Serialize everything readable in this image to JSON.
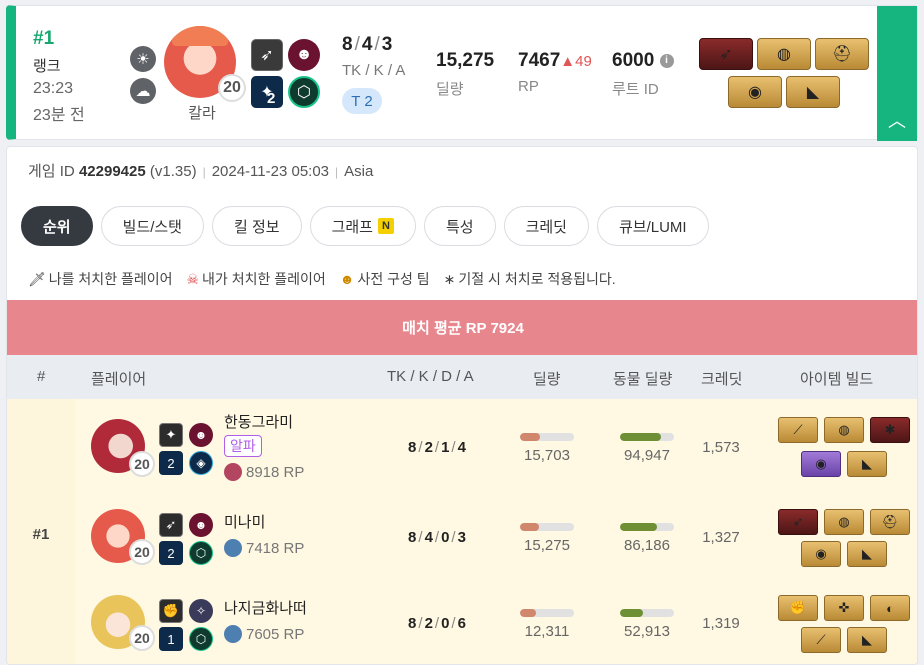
{
  "summary": {
    "rank_num": "#1",
    "rank_label": "랭크",
    "duration": "23:23",
    "ago": "23분 전",
    "character_name": "칼라",
    "level": "20",
    "trait_count": "2",
    "kda": {
      "tk": "8",
      "k": "4",
      "a": "3",
      "sep": "/"
    },
    "kda_label": "TK / K / A",
    "tier_badge": "T 2",
    "damage": "15,275",
    "damage_label": "딜량",
    "rp": "7467",
    "rp_delta": "▲49",
    "rp_label": "RP",
    "route_id": "6000",
    "route_info_icon": "i",
    "route_label": "루트 ID",
    "expand_icon": "︿"
  },
  "detail": {
    "game_id_label": "게임 ID",
    "game_id": "42299425",
    "version": "(v1.35)",
    "datetime": "2024-11-23 05:03",
    "region": "Asia",
    "meta_sep": "|",
    "tabs": [
      {
        "label": "순위",
        "active": true
      },
      {
        "label": "빌드/스탯",
        "active": false
      },
      {
        "label": "킬 정보",
        "active": false
      },
      {
        "label": "그래프",
        "active": false,
        "new": "N"
      },
      {
        "label": "특성",
        "active": false
      },
      {
        "label": "크레딧",
        "active": false
      },
      {
        "label": "큐브/LUMI",
        "active": false
      }
    ],
    "legend": [
      {
        "icon": "🗡",
        "text": "나를 처치한 플레이어"
      },
      {
        "icon": "☠",
        "text": "내가 처치한 플레이어"
      },
      {
        "icon": "☻",
        "text": "사전 구성 팀"
      },
      {
        "icon": "∗",
        "text": "기절 시 처치로 적용됩니다."
      }
    ],
    "avg_rp": "매치 평균 RP 7924",
    "headers": {
      "rank": "#",
      "player": "플레이어",
      "kda": "TK / K / D / A",
      "damage": "딜량",
      "animal_damage": "동물 딜량",
      "credit": "크레딧",
      "items": "아이템 빌드"
    },
    "team_rank": "#1",
    "players": [
      {
        "name": "한동그라미",
        "badge": "알파",
        "rp": "8918 RP",
        "level": "20",
        "trait": "2",
        "tk": "8",
        "k": "2",
        "d": "1",
        "a": "4",
        "damage": "15,703",
        "damage_ratio": 0.37,
        "animal_damage": "94,947",
        "animal_ratio": 0.76,
        "credit": "1,573"
      },
      {
        "name": "미나미",
        "badge": "",
        "rp": "7418 RP",
        "level": "20",
        "trait": "2",
        "tk": "8",
        "k": "4",
        "d": "0",
        "a": "3",
        "damage": "15,275",
        "damage_ratio": 0.36,
        "animal_damage": "86,186",
        "animal_ratio": 0.69,
        "credit": "1,327"
      },
      {
        "name": "나지금화나떠",
        "badge": "",
        "rp": "7605 RP",
        "level": "20",
        "trait": "1",
        "tk": "8",
        "k": "2",
        "d": "0",
        "a": "6",
        "damage": "12,311",
        "damage_ratio": 0.29,
        "animal_damage": "52,913",
        "animal_ratio": 0.42,
        "credit": "1,319"
      }
    ]
  },
  "colors": {
    "accent_green": "#16b47f",
    "banner_red": "#e8868e",
    "damage_bar": "#d0876c",
    "animal_bar": "#6f8f34",
    "alpha_purple": "#b15fe6",
    "rp_up": "#e05555"
  }
}
